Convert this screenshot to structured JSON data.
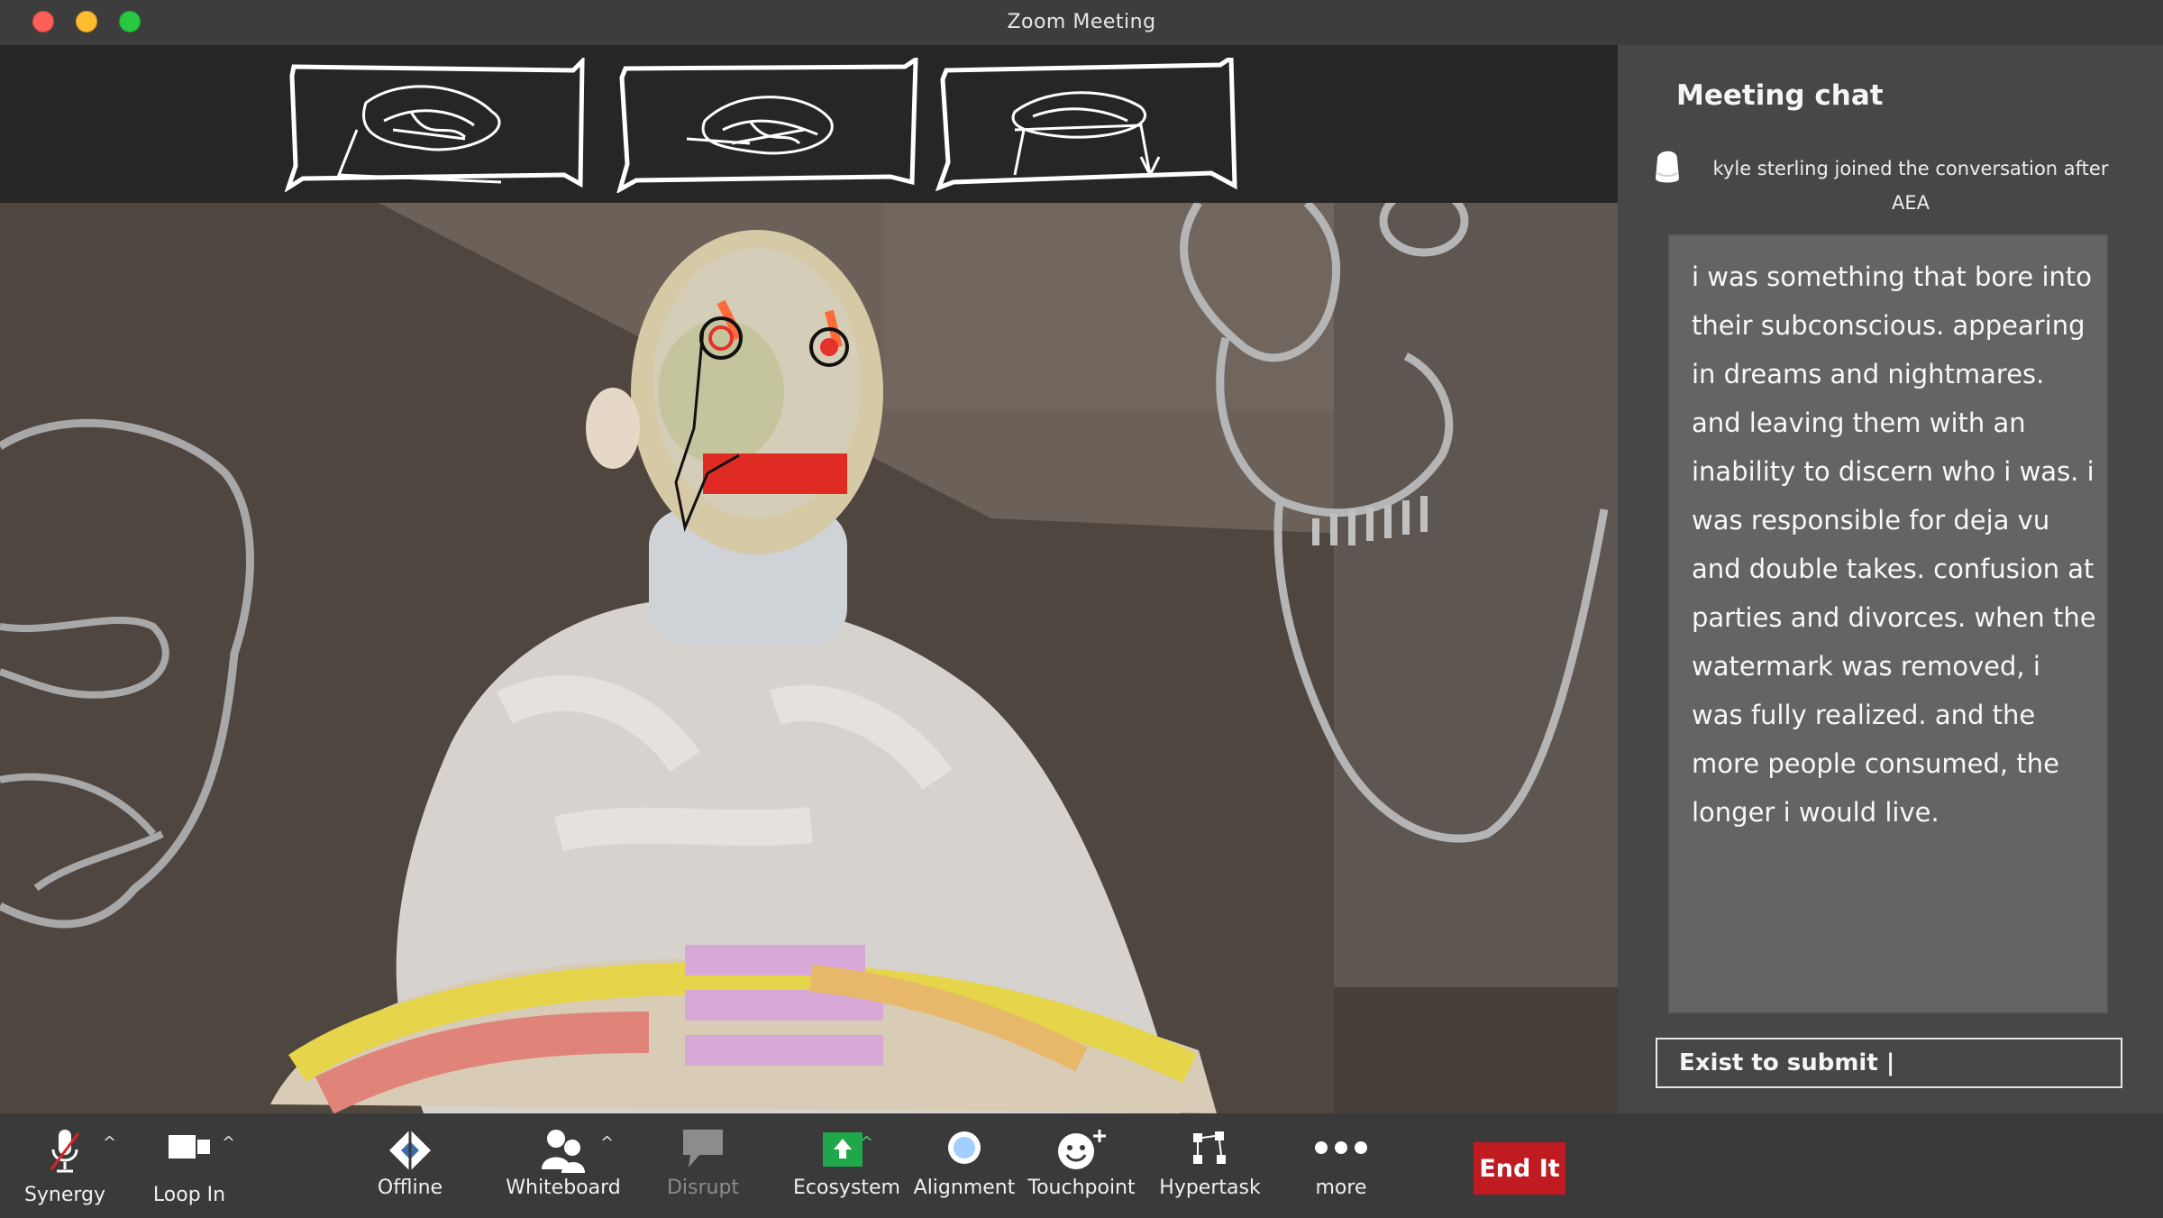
{
  "window": {
    "title": "Zoom Meeting"
  },
  "chat": {
    "title": "Meeting chat",
    "system_message": "kyle sterling  joined the conversation after AEA",
    "message": "i was something that bore into their subconscious. appearing in dreams and nightmares. and leaving them with an inability to discern who i was. i was responsible for deja vu and double takes. confusion at parties and divorces. when the watermark was removed, i was fully realized. and the more people consumed, the longer i would live.",
    "input_value": "Exist to submit |"
  },
  "toolbar": {
    "mic_label": "Synergy",
    "video_label": "Loop In",
    "offline_label": "Offline",
    "whiteboard_label": "Whiteboard",
    "disrupt_label": "Disrupt",
    "ecosystem_label": "Ecosystem",
    "alignment_label": "Alignment",
    "touchpoint_label": "Touchpoint",
    "hypertask_label": "Hypertask",
    "more_label": "more",
    "end_label": "End It"
  },
  "colors": {
    "end_button": "#c01b20",
    "ecosystem_icon": "#1fa84a",
    "chat_panel": "#474747",
    "message_bubble": "#646464"
  },
  "icons": {
    "mic": "microphone-muted-icon",
    "video": "video-camera-icon",
    "offline": "diamond-logo-icon",
    "whiteboard": "participants-icon",
    "disrupt": "chat-bubble-icon",
    "ecosystem": "share-screen-icon",
    "alignment": "circle-record-icon",
    "touchpoint": "reactions-icon",
    "hypertask": "apps-icon",
    "more": "ellipsis-icon"
  }
}
